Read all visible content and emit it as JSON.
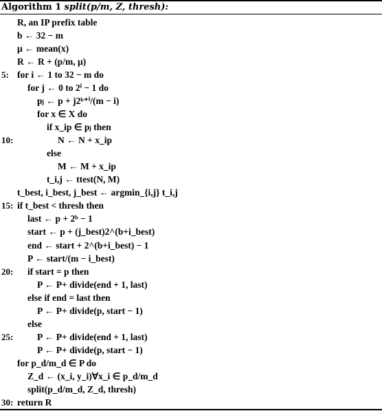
{
  "algorithm": {
    "label": "Algorithm 1",
    "signature": "split(p/m, Z, thresh):",
    "lines": [
      {
        "num": "",
        "indent": 1,
        "text": "R, an IP prefix table"
      },
      {
        "num": "",
        "indent": 1,
        "text": "b ← 32 − m"
      },
      {
        "num": "",
        "indent": 1,
        "text": "μ ← mean(x)"
      },
      {
        "num": "",
        "indent": 1,
        "text": "R ← R + (p/m, μ)"
      },
      {
        "num": "5:",
        "indent": 1,
        "text": "for i ← 1 to 32 − m do"
      },
      {
        "num": "",
        "indent": 2,
        "text": "for j ← 0 to 2ⁱ − 1 do"
      },
      {
        "num": "",
        "indent": 3,
        "text": "pⱼ ← p + j2ᵇ⁺ⁱ/(m − i)"
      },
      {
        "num": "",
        "indent": 3,
        "text": "for x ∈ X do"
      },
      {
        "num": "",
        "indent": 4,
        "text": "if x_ip ∈ pⱼ then"
      },
      {
        "num": "10:",
        "indent": 5,
        "text": "N ← N + x_ip"
      },
      {
        "num": "",
        "indent": 4,
        "text": "else"
      },
      {
        "num": "",
        "indent": 5,
        "text": "M ← M + x_ip"
      },
      {
        "num": "",
        "indent": 4,
        "text": "t_i,j ← ttest(N, M)"
      },
      {
        "num": "",
        "indent": 1,
        "text": "t_best, i_best, j_best ← argmin_{i,j} t_i,j"
      },
      {
        "num": "15:",
        "indent": 1,
        "text": "if t_best < thresh then"
      },
      {
        "num": "",
        "indent": 2,
        "text": "last ← p + 2ᵇ − 1"
      },
      {
        "num": "",
        "indent": 2,
        "text": "start ← p + (j_best)2^(b+i_best)"
      },
      {
        "num": "",
        "indent": 2,
        "text": "end ← start + 2^(b+i_best) − 1"
      },
      {
        "num": "",
        "indent": 2,
        "text": "P ← start/(m − i_best)"
      },
      {
        "num": "20:",
        "indent": 2,
        "text": "if start = p then"
      },
      {
        "num": "",
        "indent": 3,
        "text": "P ← P+ divide(end + 1, last)"
      },
      {
        "num": "",
        "indent": 2,
        "text": "else if end = last then"
      },
      {
        "num": "",
        "indent": 3,
        "text": "P ← P+ divide(p, start − 1)"
      },
      {
        "num": "",
        "indent": 2,
        "text": "else"
      },
      {
        "num": "25:",
        "indent": 3,
        "text": "P ← P+ divide(end + 1, last)"
      },
      {
        "num": "",
        "indent": 3,
        "text": "P ← P+ divide(p, start − 1)"
      },
      {
        "num": "",
        "indent": 1,
        "text": "for p_d/m_d ∈ P do"
      },
      {
        "num": "",
        "indent": 2,
        "text": "Z_d ← (x_i, y_i)∀x_i ∈ p_d/m_d"
      },
      {
        "num": "",
        "indent": 2,
        "text": "split(p_d/m_d, Z_d, thresh)"
      },
      {
        "num": "30:",
        "indent": 1,
        "text": "return R"
      }
    ]
  }
}
